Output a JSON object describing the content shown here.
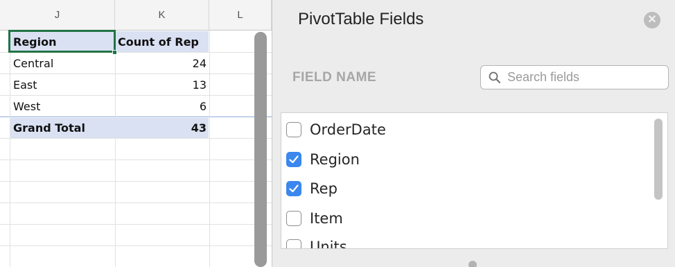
{
  "sheet": {
    "columns": [
      "J",
      "K",
      "L"
    ],
    "table": {
      "header": {
        "label": "Region",
        "value": "Count of Rep"
      },
      "rows": [
        {
          "label": "Central",
          "value": "24"
        },
        {
          "label": "East",
          "value": "13"
        },
        {
          "label": "West",
          "value": "6"
        }
      ],
      "total": {
        "label": "Grand Total",
        "value": "43"
      }
    }
  },
  "pivot": {
    "title": "PivotTable Fields",
    "field_name_header": "FIELD NAME",
    "search": {
      "placeholder": "Search fields",
      "value": ""
    },
    "fields": [
      {
        "label": "OrderDate",
        "checked": false
      },
      {
        "label": "Region",
        "checked": true
      },
      {
        "label": "Rep",
        "checked": true
      },
      {
        "label": "Item",
        "checked": false
      },
      {
        "label": "Units",
        "checked": false
      }
    ]
  },
  "colors": {
    "selection": "#217346",
    "header_band": "#d9e1f2",
    "checkbox_on": "#3b87ee"
  }
}
